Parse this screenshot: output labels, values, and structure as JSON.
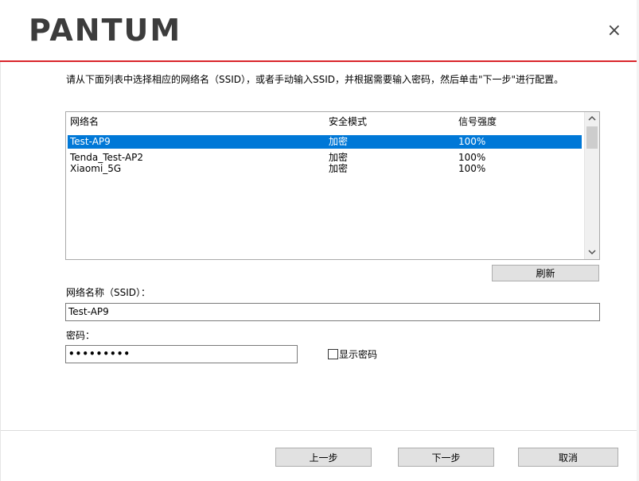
{
  "header": {
    "logo": "PANTUM",
    "close_glyph": "×",
    "accent_color": "#d9252b"
  },
  "instruction": "请从下面列表中选择相应的网络名（SSID），或者手动输入SSID，并根据需要输入密码，然后单击\"下一步\"进行配置。",
  "network_list": {
    "columns": [
      "网络名",
      "安全模式",
      "信号强度"
    ],
    "rows": [
      {
        "name": "Test-AP9",
        "security": "加密",
        "signal": "100%",
        "selected": true
      },
      {
        "name": "Tenda_Test-AP2",
        "security": "加密",
        "signal": "100%",
        "selected": false
      },
      {
        "name": "Xiaomi_5G",
        "security": "加密",
        "signal": "100%",
        "selected": false
      }
    ],
    "scroll_up_icon": "chevron-up-icon",
    "scroll_down_icon": "chevron-down-icon"
  },
  "refresh_label": "刷新",
  "ssid": {
    "label": "网络名称（SSID）：",
    "value": "Test-AP9"
  },
  "password": {
    "label": "密码：",
    "value": "•••••••••"
  },
  "show_password": {
    "label": "显示密码",
    "checked": false
  },
  "footer": {
    "prev_label": "上一步",
    "next_label": "下一步",
    "cancel_label": "取消"
  }
}
